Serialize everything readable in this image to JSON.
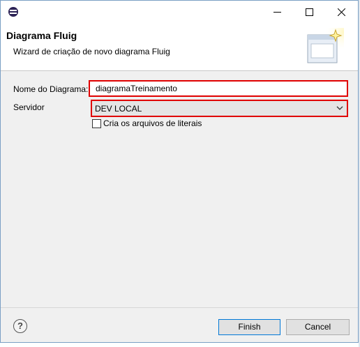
{
  "window": {
    "title_bar": {
      "app_icon": "eclipse-icon",
      "min_icon": "minimize-icon",
      "max_icon": "maximize-icon",
      "close_icon": "close-icon"
    },
    "banner": {
      "title": "Diagrama Fluig",
      "description": "Wizard de criação de novo diagrama Fluig",
      "icon": "wizard-banner-icon"
    },
    "form": {
      "name_label": "Nome do Diagrama:",
      "name_value": "diagramaTreinamento",
      "server_label": "Servidor",
      "server_value": "DEV LOCAL",
      "checkbox_label": "Cria os arquivos de literais",
      "checkbox_checked": false,
      "highlight_color": "#e00000"
    },
    "footer": {
      "help_label": "?",
      "finish_label": "Finish",
      "cancel_label": "Cancel"
    }
  }
}
